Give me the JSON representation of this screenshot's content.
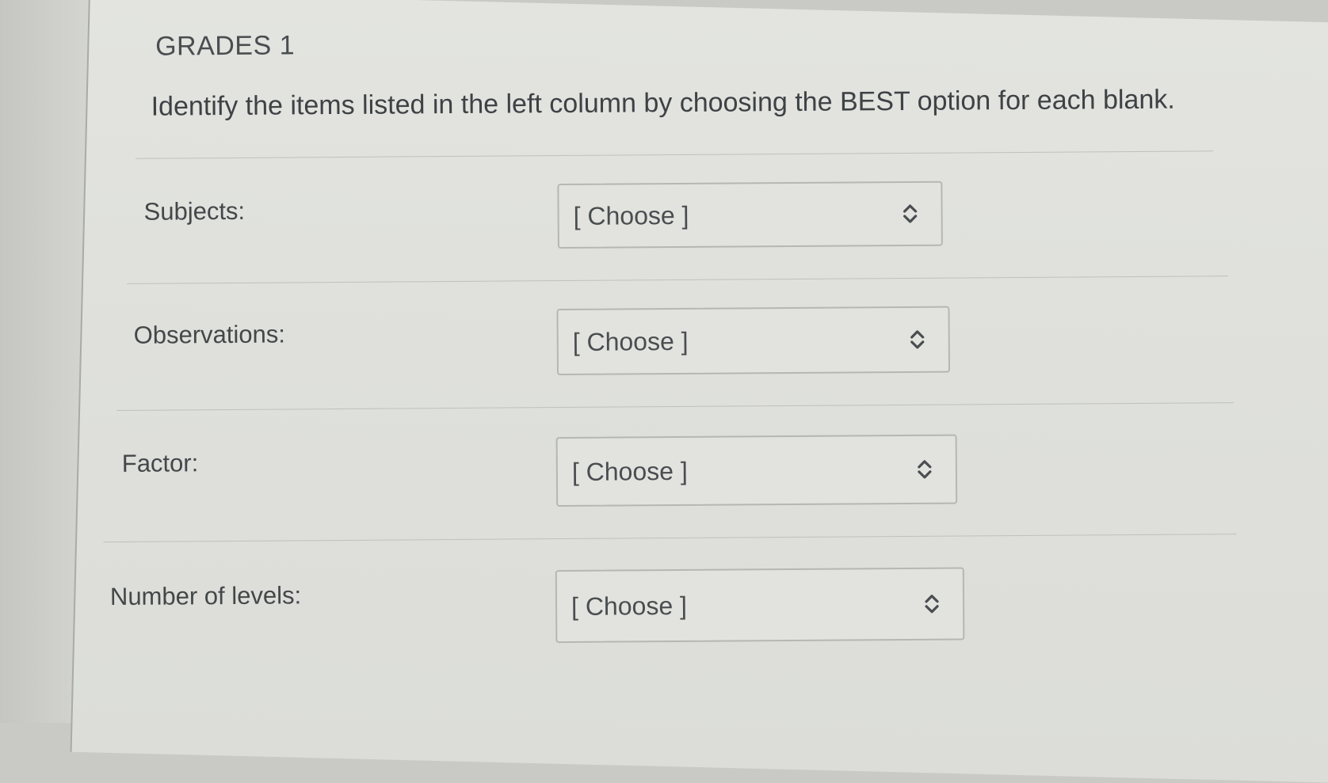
{
  "quiz": {
    "title": "GRADES 1",
    "instructions": "Identify the items listed in the left column by choosing the BEST option for each blank.",
    "rows": [
      {
        "label": "Subjects:",
        "select_value": "[ Choose ]"
      },
      {
        "label": "Observations:",
        "select_value": "[ Choose ]"
      },
      {
        "label": "Factor:",
        "select_value": "[ Choose ]"
      },
      {
        "label": "Number of levels:",
        "select_value": "[ Choose ]"
      }
    ]
  },
  "icons": {
    "select_arrow": "up-down-chevron-icon"
  },
  "colors": {
    "page_background": "#dfe0dc",
    "text": "#3f4346",
    "select_border": "#b5b7b3"
  }
}
